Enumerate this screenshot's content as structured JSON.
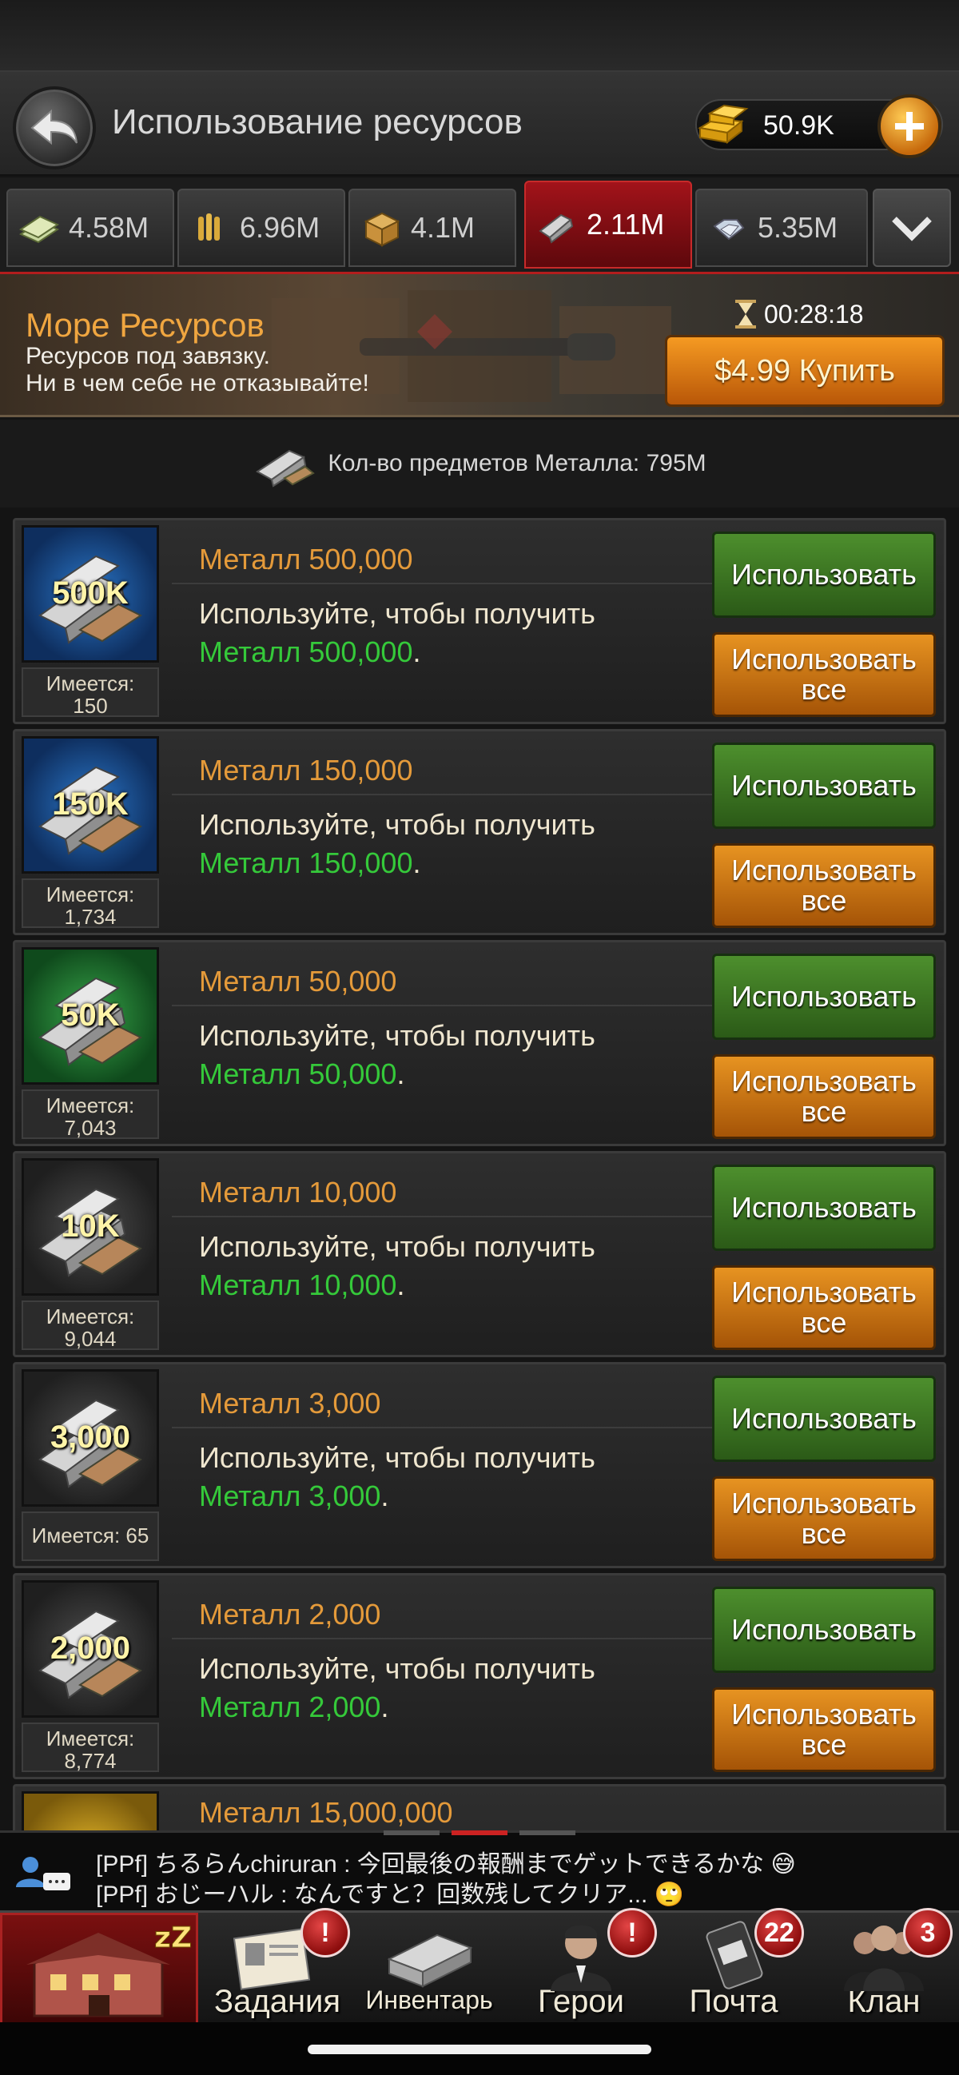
{
  "header": {
    "title": "Использование ресурсов",
    "gold": "50.9K",
    "back_icon": "back-arrow-icon",
    "add_icon": "plus-icon"
  },
  "tabs": [
    {
      "icon": "cash-icon",
      "label": "4.58M",
      "active": false
    },
    {
      "icon": "ammo-icon",
      "label": "6.96M",
      "active": false
    },
    {
      "icon": "crate-icon",
      "label": "4.1M",
      "active": false
    },
    {
      "icon": "metal-icon",
      "label": "2.11M",
      "active": true
    },
    {
      "icon": "diamond-icon",
      "label": "5.35M",
      "active": false
    }
  ],
  "banner": {
    "title": "Море Ресурсов",
    "line1": "Ресурсов под завязку.",
    "line2": "Ни в чем себе не отказывайте!",
    "timer": "00:28:18",
    "buy_label": "$4.99 Купить"
  },
  "inventory": {
    "count_text": "Кол-во предметов Металла: 795M"
  },
  "items": [
    {
      "thumb": "500K",
      "owned": "Имеется:\n150",
      "name": "Металл 500,000",
      "desc": "Используйте, чтобы получить",
      "reward": "Металл 500,000",
      "use": "Использовать",
      "use_all": "Использовать все",
      "color": "blue"
    },
    {
      "thumb": "150K",
      "owned": "Имеется:\n1,734",
      "name": "Металл 150,000",
      "desc": "Используйте, чтобы получить",
      "reward": "Металл 150,000",
      "use": "Использовать",
      "use_all": "Использовать все",
      "color": "blue"
    },
    {
      "thumb": "50K",
      "owned": "Имеется:\n7,043",
      "name": "Металл 50,000",
      "desc": "Используйте, чтобы получить",
      "reward": "Металл 50,000",
      "use": "Использовать",
      "use_all": "Использовать все",
      "color": "green"
    },
    {
      "thumb": "10K",
      "owned": "Имеется:\n9,044",
      "name": "Металл 10,000",
      "desc": "Используйте, чтобы получить",
      "reward": "Металл 10,000",
      "use": "Использовать",
      "use_all": "Использовать все",
      "color": "gray"
    },
    {
      "thumb": "3,000",
      "owned": "Имеется: 65",
      "name": "Металл 3,000",
      "desc": "Используйте, чтобы получить",
      "reward": "Металл 3,000",
      "use": "Использовать",
      "use_all": "Использовать все",
      "color": "gray"
    },
    {
      "thumb": "2,000",
      "owned": "Имеется:\n8,774",
      "name": "Металл 2,000",
      "desc": "Используйте, чтобы получить",
      "reward": "Металл 2,000",
      "use": "Использовать",
      "use_all": "Использовать все",
      "color": "gray"
    },
    {
      "thumb": "",
      "owned": "",
      "name": "Металл 15,000,000",
      "desc": "",
      "reward": "",
      "use": "",
      "use_all": "",
      "color": "gold"
    }
  ],
  "chat": {
    "line1": "[PPf] ちるらんchiruran : 今回最後の報酬までゲットできるかな 😅",
    "line2": "[PPf] おじーハル : なんですと？回数残してクリア... 🙄"
  },
  "nav": [
    {
      "icon": "headquarters-icon",
      "label": "",
      "badge": ""
    },
    {
      "icon": "tasks-icon",
      "label": "Задания",
      "badge": "!"
    },
    {
      "icon": "inventory-icon",
      "label": "Инвентарь",
      "badge": ""
    },
    {
      "icon": "heroes-icon",
      "label": "Герои",
      "badge": "!"
    },
    {
      "icon": "mail-icon",
      "label": "Почта",
      "badge": "22"
    },
    {
      "icon": "clan-icon",
      "label": "Клан",
      "badge": "3"
    }
  ],
  "colors": {
    "accent_orange": "#e49a3a",
    "reward_green": "#35c93a",
    "active_tab": "#a2131a",
    "use_button": "#4d8f2d",
    "use_all_button": "#e79321"
  }
}
